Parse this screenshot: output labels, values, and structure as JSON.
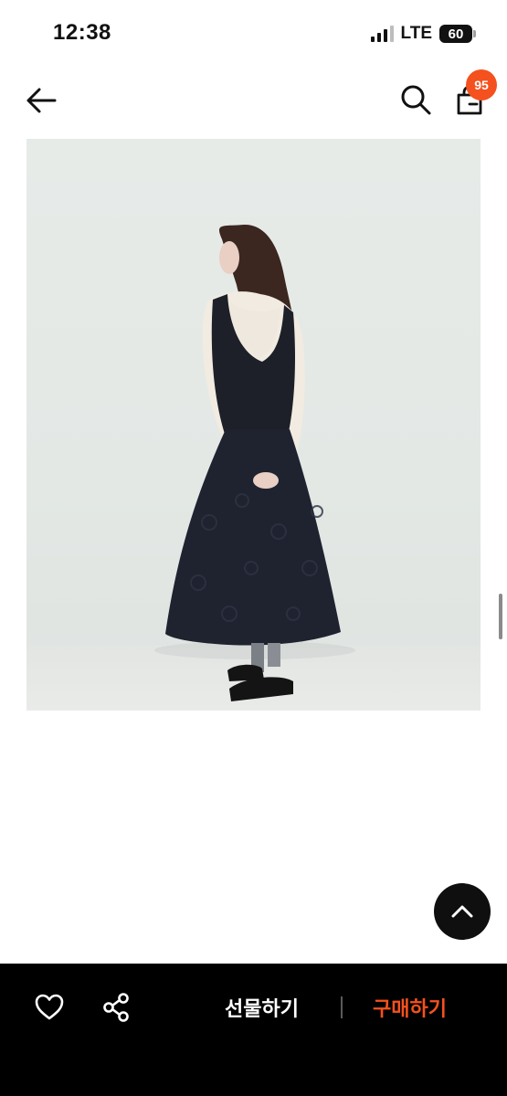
{
  "status_bar": {
    "time": "12:38",
    "network": "LTE",
    "battery": "60"
  },
  "nav": {
    "back_icon": "arrow-left-icon",
    "search_icon": "search-icon",
    "cart_icon": "shopping-bag-icon",
    "cart_count": "95"
  },
  "product": {
    "image_icon": "product-photo"
  },
  "bottom_bar": {
    "like_icon": "heart-icon",
    "share_icon": "share-icon",
    "gift_label": "선물하기",
    "buy_label": "구매하기"
  },
  "colors": {
    "accent": "#f4511e",
    "bottom_bar_bg": "#000000"
  }
}
